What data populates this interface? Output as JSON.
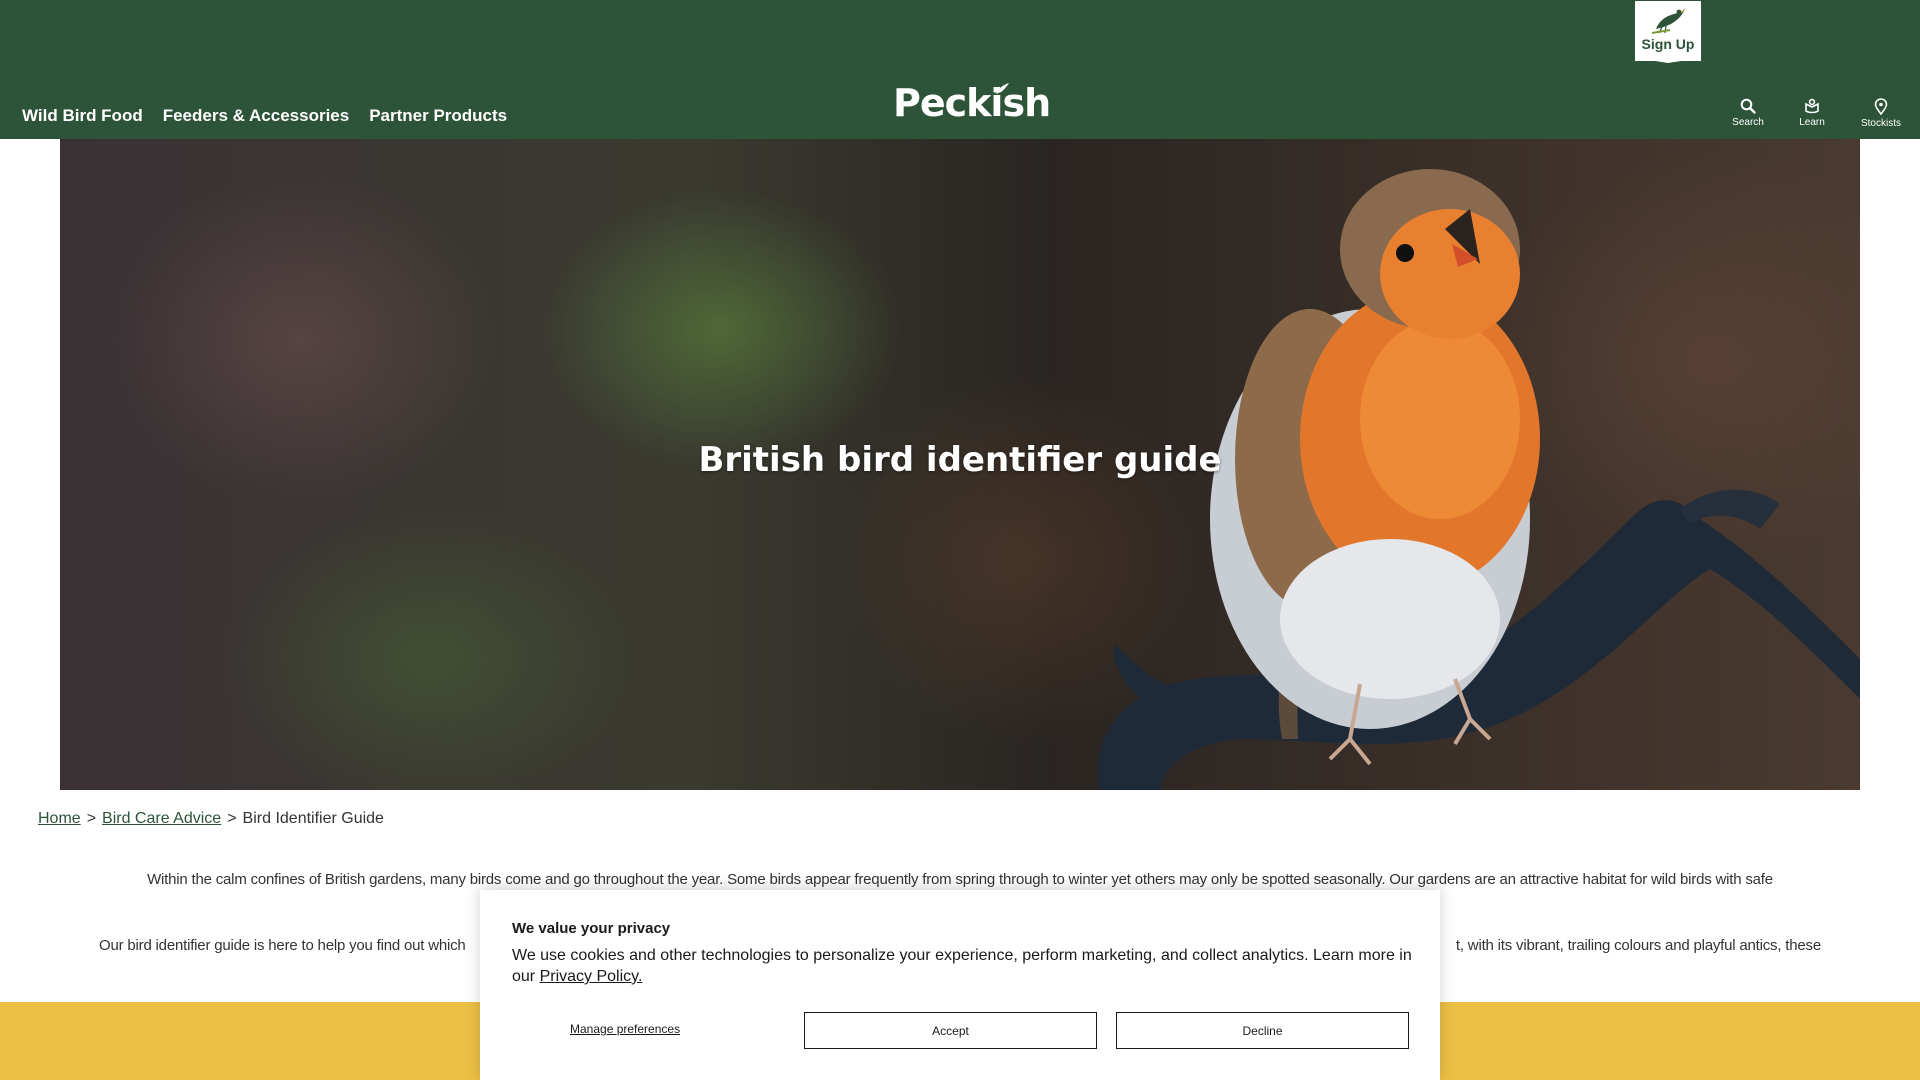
{
  "header": {
    "nav": [
      "Wild Bird Food",
      "Feeders & Accessories",
      "Partner Products"
    ],
    "logo_text": "Peckish",
    "signup_label": "Sign Up",
    "utilities": [
      {
        "label": "Search",
        "icon": "search-icon"
      },
      {
        "label": "Learn",
        "icon": "learn-icon"
      },
      {
        "label": "Stockists",
        "icon": "location-pin-icon"
      }
    ],
    "colors": {
      "background": "#2d5339",
      "text": "#ffffff"
    }
  },
  "hero": {
    "title": "British bird identifier guide",
    "image_subject": "robin perched on branch"
  },
  "breadcrumb": {
    "home": "Home",
    "sep1": ">",
    "bird_care": "Bird Care Advice",
    "sep2": ">",
    "current": "Bird Identifier Guide"
  },
  "intro": {
    "line1": "Within the calm confines of British gardens, many birds come and go throughout the year. Some birds appear frequently from spring through to winter yet others may only be spotted seasonally. Our gardens are an attractive habitat for wild birds with safe",
    "line2_start": "Our bird identifier guide is here to help you find out which",
    "line2_end": "t, with its vibrant, trailing colours and playful antics, these"
  },
  "cookie": {
    "title": "We value your privacy",
    "body": "We use cookies and other technologies to personalize your experience, perform marketing, and collect analytics. Learn more in our",
    "policy_link": "Privacy Policy.",
    "manage": "Manage preferences",
    "accept": "Accept",
    "decline": "Decline"
  },
  "colors": {
    "accent_band": "#ecc045",
    "link": "#2d5339"
  }
}
